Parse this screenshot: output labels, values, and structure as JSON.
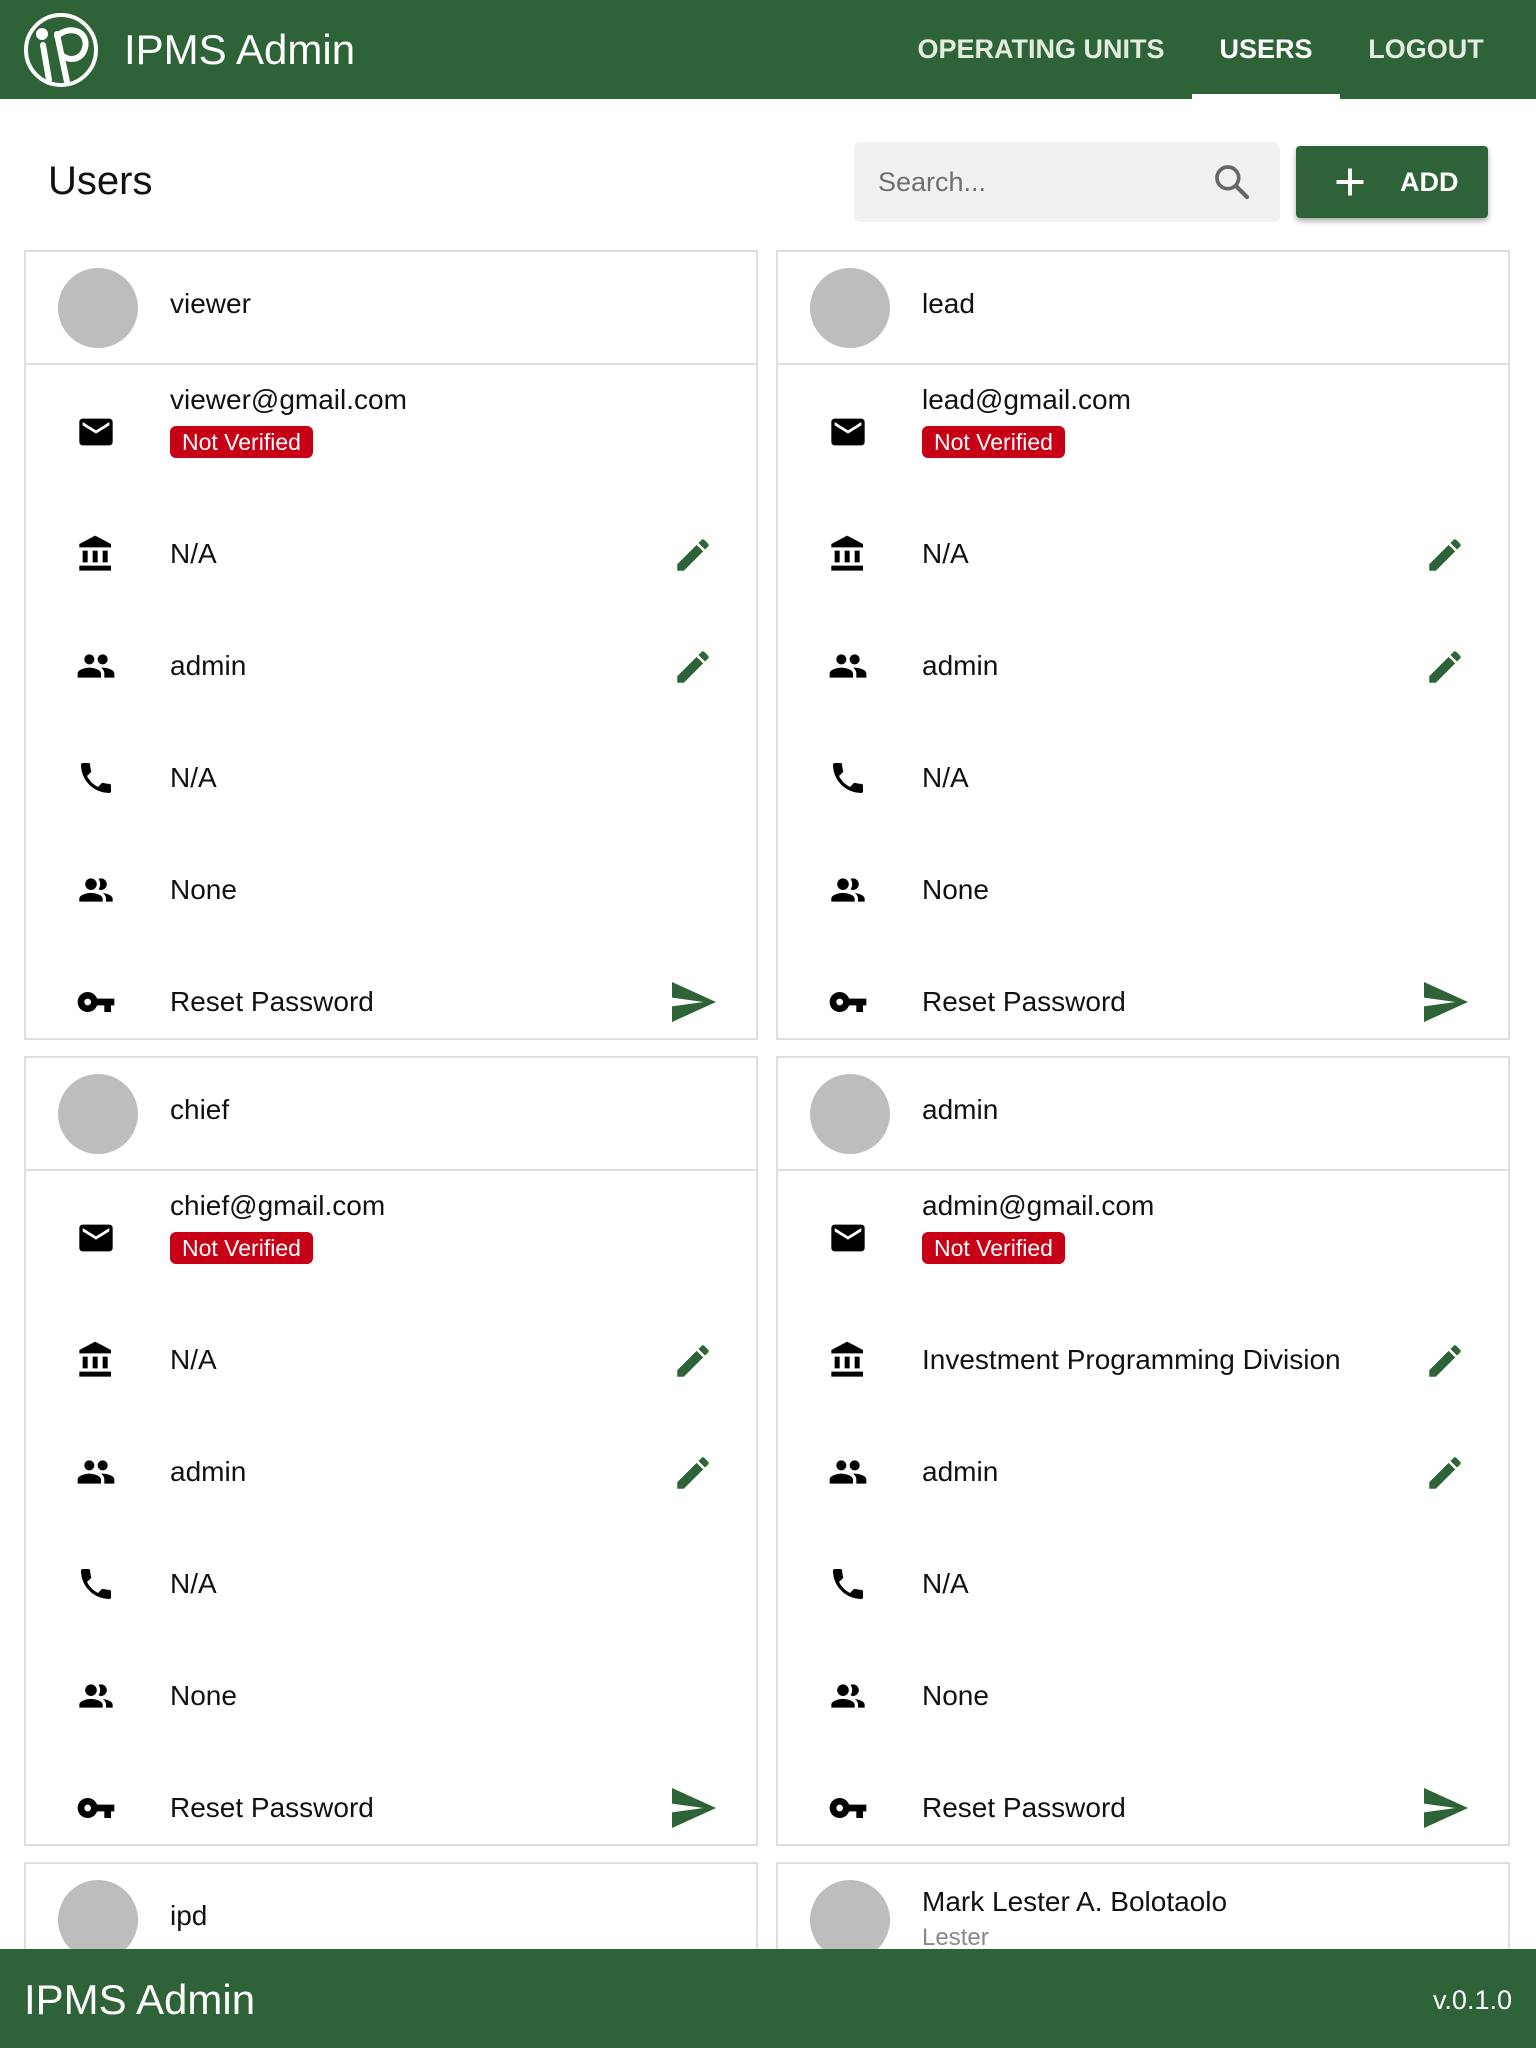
{
  "app": {
    "title": "IPMS Admin",
    "logo_icon": "ipms-logo"
  },
  "nav": {
    "operating_units": "OPERATING UNITS",
    "users": "USERS",
    "logout": "LOGOUT",
    "active": "USERS"
  },
  "page": {
    "title": "Users",
    "search_placeholder": "Search...",
    "add_label": "ADD"
  },
  "labels": {
    "not_verified": "Not Verified",
    "reset_password": "Reset Password"
  },
  "users": [
    {
      "name": "viewer",
      "email": "viewer@gmail.com",
      "operating_unit": "N/A",
      "role": "admin",
      "phone": "N/A",
      "group": "None"
    },
    {
      "name": "lead",
      "email": "lead@gmail.com",
      "operating_unit": "N/A",
      "role": "admin",
      "phone": "N/A",
      "group": "None"
    },
    {
      "name": "chief",
      "email": "chief@gmail.com",
      "operating_unit": "N/A",
      "role": "admin",
      "phone": "N/A",
      "group": "None"
    },
    {
      "name": "admin",
      "email": "admin@gmail.com",
      "operating_unit": "Investment Programming Division",
      "role": "admin",
      "phone": "N/A",
      "group": "None"
    },
    {
      "name": "ipd"
    },
    {
      "name": "Mark Lester A. Bolotaolo",
      "nickname": "Lester"
    }
  ],
  "footer": {
    "title": "IPMS Admin",
    "version": "v.0.1.0"
  },
  "colors": {
    "primary": "#2e6237",
    "badge": "#c70015",
    "avatar": "#bdbdbd",
    "border": "#dedede"
  }
}
